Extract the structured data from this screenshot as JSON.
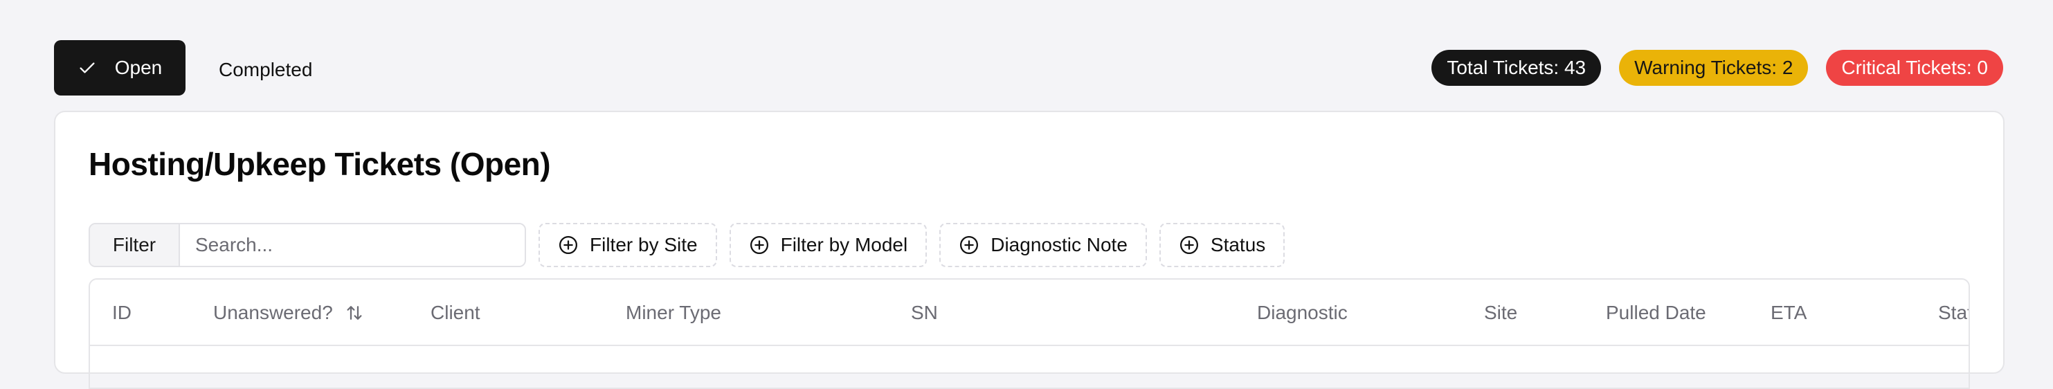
{
  "tabs": {
    "open_label": "Open",
    "completed_label": "Completed"
  },
  "badges": {
    "total": "Total Tickets: 43",
    "warning": "Warning Tickets: 2",
    "critical": "Critical Tickets: 0"
  },
  "card": {
    "title": "Hosting/Upkeep Tickets (Open)"
  },
  "filters": {
    "label": "Filter",
    "placeholder": "Search...",
    "site": "Filter by Site",
    "model": "Filter by Model",
    "diagnostic": "Diagnostic Note",
    "status": "Status"
  },
  "table": {
    "columns": [
      "ID",
      "Unanswered?",
      "Client",
      "Miner Type",
      "SN",
      "Diagnostic",
      "Site",
      "Pulled Date",
      "ETA",
      "Status"
    ]
  },
  "colors": {
    "primary": "#161616",
    "warning": "#eab308",
    "critical": "#ef4444"
  }
}
